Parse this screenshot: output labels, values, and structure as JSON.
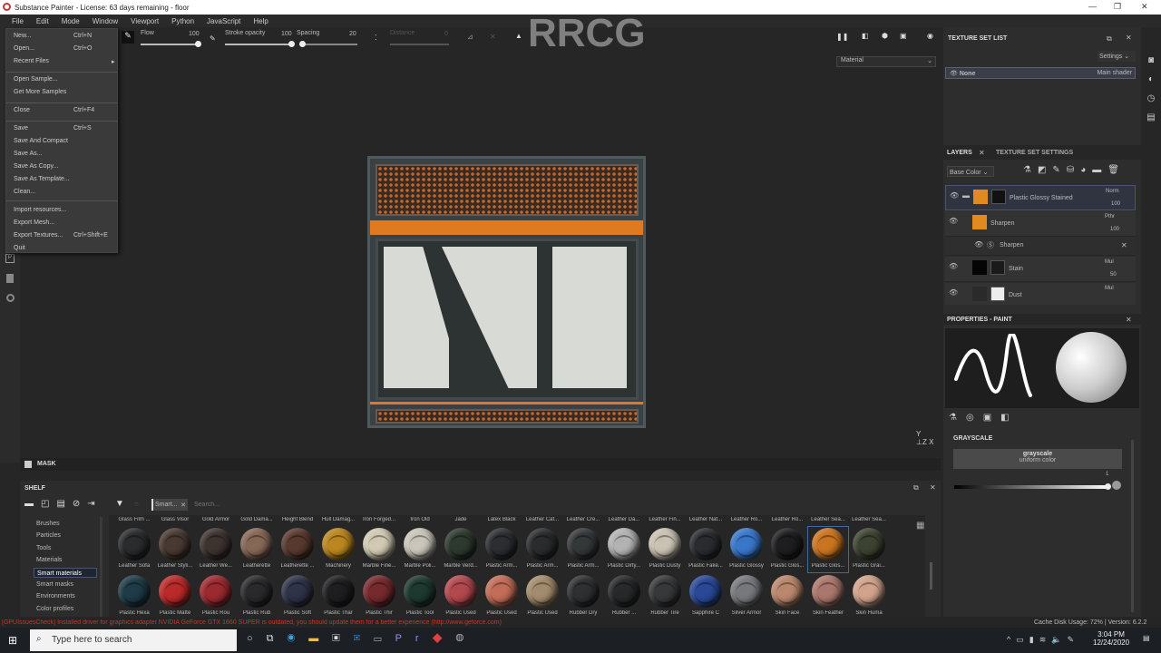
{
  "window": {
    "title": "Substance Painter - License: 63 days remaining - floor",
    "controls": [
      "—",
      "❐",
      "✕"
    ]
  },
  "menubar": [
    "File",
    "Edit",
    "Mode",
    "Window",
    "Viewport",
    "Python",
    "JavaScript",
    "Help"
  ],
  "toolbar": {
    "flow_label": "Flow",
    "flow_value": "100",
    "stroke_opacity_label": "Stroke opacity",
    "stroke_opacity_value": "100",
    "spacing_label": "Spacing",
    "spacing_value": "20",
    "distance_label": "Distance",
    "distance_value": "0"
  },
  "file_menu": [
    {
      "label": "New...",
      "shortcut": "Ctrl+N"
    },
    {
      "label": "Open...",
      "shortcut": "Ctrl+O"
    },
    {
      "label": "Recent Files",
      "shortcut": "▸"
    },
    {
      "label": "Open Sample...",
      "shortcut": ""
    },
    {
      "label": "Get More Samples",
      "shortcut": ""
    },
    {
      "label": "Close",
      "shortcut": "Ctrl+F4"
    },
    {
      "label": "Save",
      "shortcut": "Ctrl+S"
    },
    {
      "label": "Save And Compact",
      "shortcut": ""
    },
    {
      "label": "Save As...",
      "shortcut": ""
    },
    {
      "label": "Save As Copy...",
      "shortcut": ""
    },
    {
      "label": "Save As Template...",
      "shortcut": ""
    },
    {
      "label": "Clean...",
      "shortcut": ""
    },
    {
      "label": "Import resources...",
      "shortcut": ""
    },
    {
      "label": "Export Mesh...",
      "shortcut": ""
    },
    {
      "label": "Export Textures...",
      "shortcut": "Ctrl+Shift+E"
    },
    {
      "label": "Quit",
      "shortcut": ""
    }
  ],
  "viewport": {
    "material_mode": "Material",
    "watermark": "RRCG"
  },
  "texture_set_list": {
    "title": "TEXTURE SET LIST",
    "settings": "Settings",
    "item_name": "None",
    "item_shader": "Main shader"
  },
  "layers": {
    "tab_layers": "LAYERS",
    "tab_tss": "TEXTURE SET SETTINGS",
    "channel": "Base Color",
    "items": [
      {
        "name": "Plastic Glossy Stained",
        "blend": "Norm",
        "opacity": "100"
      },
      {
        "name": "Sharpen",
        "blend": "Pthr",
        "opacity": "100"
      },
      {
        "name": "Sharpen",
        "blend": "",
        "opacity": ""
      },
      {
        "name": "Stain",
        "blend": "Mul",
        "opacity": "50"
      },
      {
        "name": "Dust",
        "blend": "Mul",
        "opacity": ""
      }
    ]
  },
  "properties": {
    "title": "PROPERTIES - PAINT",
    "section": "GRAYSCALE",
    "button_title": "grayscale",
    "button_sub": "uniform color",
    "slider_value": "1",
    "slider_fraction": 1.0
  },
  "mask_label": "MASK",
  "shelf": {
    "title": "SHELF",
    "filter_tag": "Smart...",
    "search_placeholder": "Search...",
    "categories": [
      "Brushes",
      "Particles",
      "Tools",
      "Materials",
      "Smart materials",
      "Smart masks",
      "Environments",
      "Color profiles"
    ],
    "selected_category": "Smart materials",
    "top_labels": [
      "Glass Film ...",
      "Glass Visor",
      "Gold Armor",
      "Gold Dama...",
      "Height Blend",
      "Hull Damag...",
      "Iron Forged...",
      "Iron Old",
      "Jade",
      "Latex Black",
      "Leather Caf...",
      "Leather Cre...",
      "Leather Da...",
      "Leather Fin...",
      "Leather Nat...",
      "Leather Ro...",
      "Leather Ro...",
      "Leather Sea...",
      "Leather Sea..."
    ],
    "row1": [
      {
        "label": "Leather Sofa",
        "color": "#2a2c2e"
      },
      {
        "label": "Leather Styli...",
        "color": "#4a3a32"
      },
      {
        "label": "Leather We...",
        "color": "#3e3430"
      },
      {
        "label": "Leatherette",
        "color": "#8a6a58"
      },
      {
        "label": "Leatherette ...",
        "color": "#5a3a30"
      },
      {
        "label": "Machinery",
        "color": "#c08a20"
      },
      {
        "label": "Marble Fine...",
        "color": "#d8d0b8"
      },
      {
        "label": "Marble Poli...",
        "color": "#d0ccc0"
      },
      {
        "label": "Marble Verd...",
        "color": "#2e3a30"
      },
      {
        "label": "Plastic Arm...",
        "color": "#2c2e32"
      },
      {
        "label": "Plastic Arm...",
        "color": "#2a2c2e"
      },
      {
        "label": "Plastic Arm...",
        "color": "#35383a"
      },
      {
        "label": "Plastic Dirty...",
        "color": "#b8b8b8"
      },
      {
        "label": "Plastic Dusty",
        "color": "#d0c8b8"
      },
      {
        "label": "Plastic Fake...",
        "color": "#2a2c30"
      },
      {
        "label": "Plastic Glossy",
        "color": "#3a7ad0"
      },
      {
        "label": "Plastic Glos...",
        "color": "#1e1e20"
      },
      {
        "label": "Plastic Glos...",
        "color": "#d07820"
      },
      {
        "label": "Plastic Grai...",
        "color": "#3e4432"
      }
    ],
    "row2": [
      {
        "label": "Plastic Hexa",
        "color": "#1e3c48"
      },
      {
        "label": "Plastic Matte",
        "color": "#c02a2a"
      },
      {
        "label": "Plastic Rou",
        "color": "#a02a30"
      },
      {
        "label": "Plastic Rub",
        "color": "#2a2a2c"
      },
      {
        "label": "Plastic Soft",
        "color": "#30344a"
      },
      {
        "label": "Plastic Thar",
        "color": "#1e1e20"
      },
      {
        "label": "Plastic Thir",
        "color": "#7a2a2e"
      },
      {
        "label": "Plastic Tool",
        "color": "#1e3a30"
      },
      {
        "label": "Plastic Used",
        "color": "#b84a50"
      },
      {
        "label": "Plastic Used",
        "color": "#c8705a"
      },
      {
        "label": "Plastic Used",
        "color": "#a89070"
      },
      {
        "label": "Rubber Dry",
        "color": "#2e3032"
      },
      {
        "label": "Rubber ...",
        "color": "#28292b"
      },
      {
        "label": "Rubber Tire",
        "color": "#38393b"
      },
      {
        "label": "Sapphire C",
        "color": "#2a4a9a"
      },
      {
        "label": "Silver Armor",
        "color": "#7a7c80"
      },
      {
        "label": "Skin Face",
        "color": "#c08a70"
      },
      {
        "label": "Skin Feather",
        "color": "#b07a70"
      },
      {
        "label": "Skin Huma",
        "color": "#d8a890"
      }
    ],
    "selected_index": 17
  },
  "status": {
    "log": "[GPUIssuesCheck] Installed driver for graphics adapter NVIDIA GeForce GTX 1660 SUPER is outdated, you should update them for a better experience (http://www.geforce.com)",
    "cache": "Cache Disk Usage:   72% | Version: 6.2.2"
  },
  "taskbar": {
    "search_placeholder": "Type here to search",
    "time": "3:04 PM",
    "date": "12/24/2020"
  }
}
